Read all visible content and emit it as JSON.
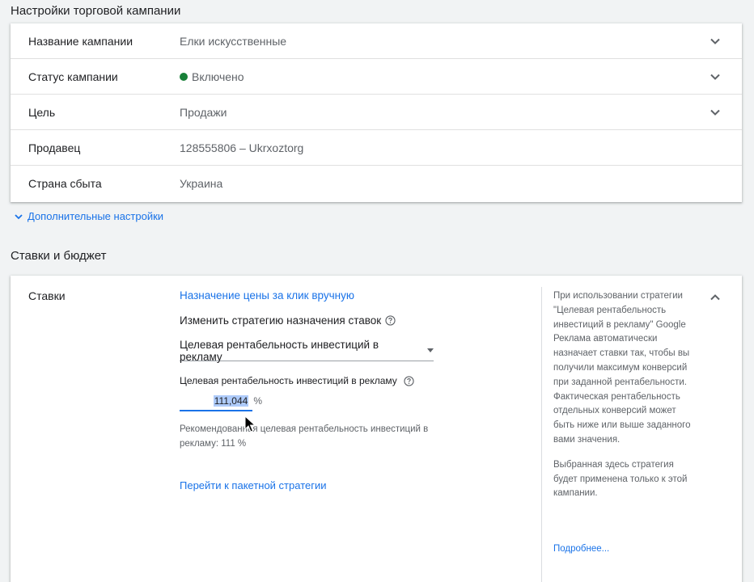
{
  "settings": {
    "title": "Настройки торговой кампании",
    "rows": [
      {
        "label": "Название кампании",
        "value": "Елки искусственные",
        "expandable": true
      },
      {
        "label": "Статус кампании",
        "value": "Включено",
        "expandable": true,
        "status_color": "#188038"
      },
      {
        "label": "Цель",
        "value": "Продажи",
        "expandable": true
      },
      {
        "label": "Продавец",
        "value": "128555806 – Ukrxoztorg",
        "expandable": false
      },
      {
        "label": "Страна сбыта",
        "value": "Украина",
        "expandable": false
      }
    ],
    "more_link": "Дополнительные настройки"
  },
  "bids_budget": {
    "title": "Ставки и бюджет",
    "bids_label": "Ставки",
    "manual_cpc_link": "Назначение цены за клик вручную",
    "change_strategy_label": "Изменить стратегию назначения ставок",
    "strategy_selected": "Целевая рентабельность инвестиций в рекламу",
    "target_label": "Целевая рентабельность инвестиций в рекламу",
    "target_value": "111,044",
    "target_unit": "%",
    "recommendation": "Рекомендованная целевая рентабельность инвестиций в рекламу: 111 %",
    "portfolio_link": "Перейти к пакетной стратегии",
    "help_paragraph_1": "При использовании стратегии \"Целевая рентабельность инвестиций в рекламу\" Google Реклама автоматически назначает ставки так, чтобы вы получили максимум конверсий при заданной рентабельности. Фактическая рентабельность отдельных конверсий может быть ниже или выше заданного вами значения.",
    "help_paragraph_2": "Выбранная здесь стратегия будет применена только к этой кампании.",
    "learn_more_link": "Подробнее..."
  },
  "colors": {
    "accent": "#1a73e8",
    "status_on": "#188038",
    "selection": "#aecbfa"
  }
}
